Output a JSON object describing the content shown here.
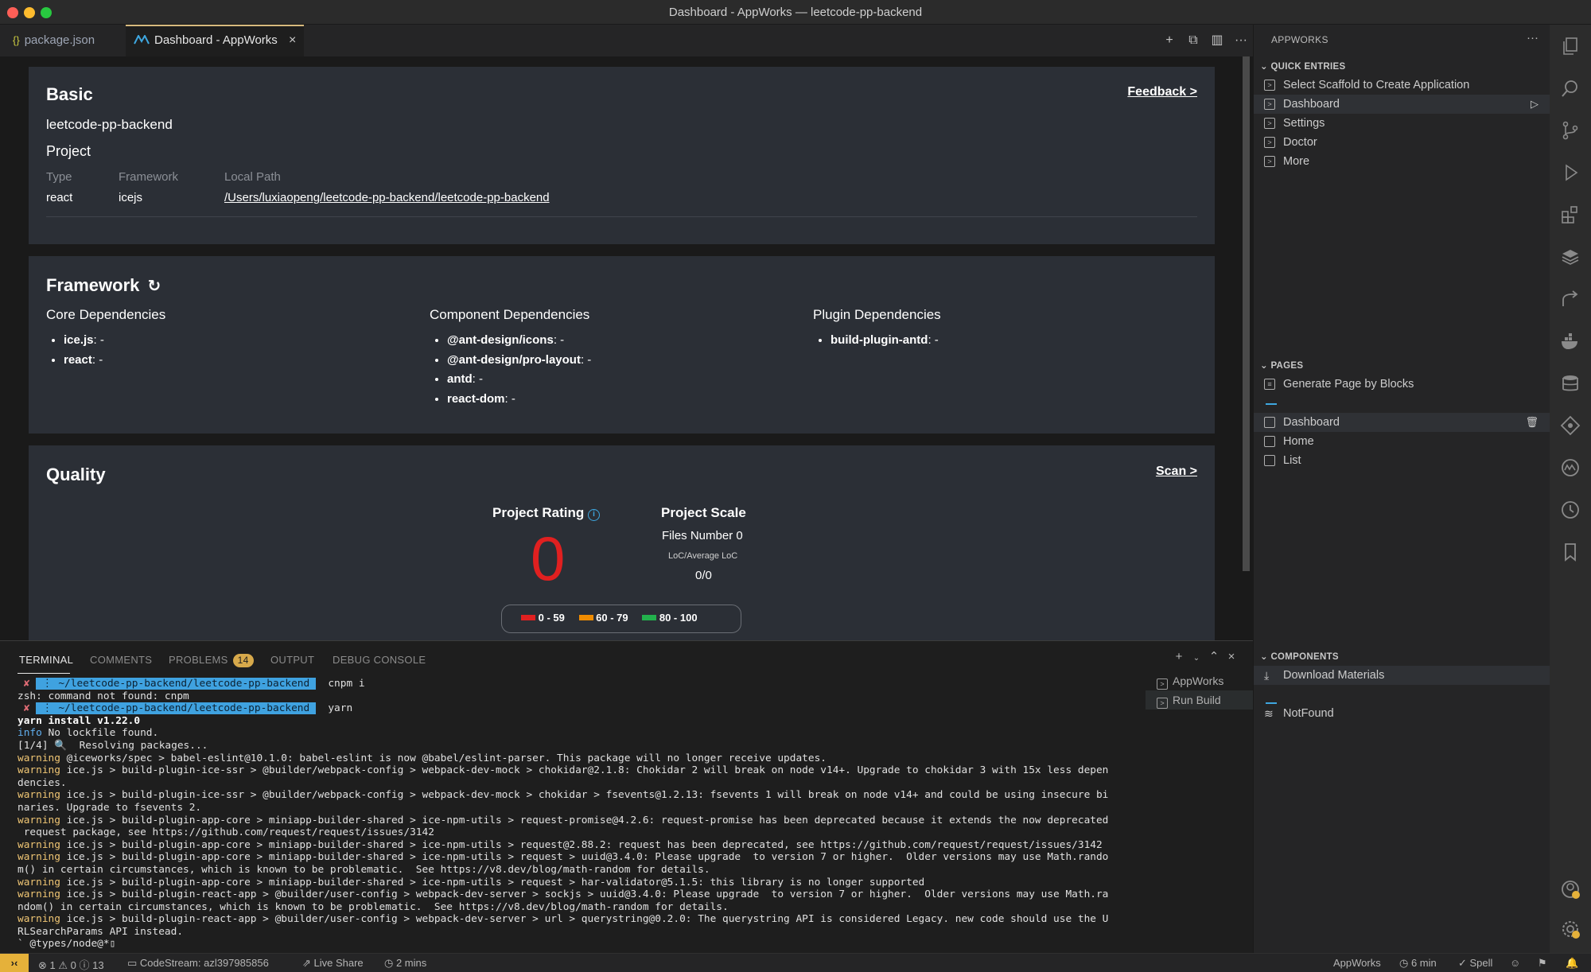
{
  "window": {
    "title": "Dashboard - AppWorks — leetcode-pp-backend"
  },
  "tabs": [
    {
      "label": "package.json",
      "icon": "{}"
    },
    {
      "label": "Dashboard - AppWorks"
    }
  ],
  "basic": {
    "heading": "Basic",
    "project_name": "leetcode-pp-backend",
    "feedback_link": "Feedback >",
    "subheading": "Project",
    "columns": {
      "type": "Type",
      "framework": "Framework",
      "local_path": "Local Path"
    },
    "values": {
      "type": "react",
      "framework": "icejs",
      "local_path": "/Users/luxiaopeng/leetcode-pp-backend/leetcode-pp-backend"
    }
  },
  "framework": {
    "heading": "Framework",
    "core": {
      "title": "Core Dependencies",
      "items": [
        {
          "name": "ice.js",
          "value": ": -"
        },
        {
          "name": "react",
          "value": ": -"
        }
      ]
    },
    "component": {
      "title": "Component Dependencies",
      "items": [
        {
          "name": "@ant-design/icons",
          "value": ": -"
        },
        {
          "name": "@ant-design/pro-layout",
          "value": ": -"
        },
        {
          "name": "antd",
          "value": ": -"
        },
        {
          "name": "react-dom",
          "value": ": -"
        }
      ]
    },
    "plugin": {
      "title": "Plugin Dependencies",
      "items": [
        {
          "name": "build-plugin-antd",
          "value": ": -"
        }
      ]
    }
  },
  "quality": {
    "heading": "Quality",
    "scan_link": "Scan >",
    "rating_label": "Project Rating",
    "rating_value": "0",
    "scale_label": "Project Scale",
    "files_number": "Files Number 0",
    "loc_label": "LoC/Average LoC",
    "loc_value": "0/0",
    "legend": [
      {
        "label": "0 - 59",
        "color": "#e02020"
      },
      {
        "label": "60 - 79",
        "color": "#f08c00"
      },
      {
        "label": "80 - 100",
        "color": "#22b14c"
      }
    ]
  },
  "panel": {
    "tabs": {
      "terminal": "TERMINAL",
      "comments": "COMMENTS",
      "problems": "PROBLEMS",
      "problems_count": "14",
      "output": "OUTPUT",
      "debug": "DEBUG CONSOLE"
    },
    "terminal_list": [
      "AppWorks",
      "Run Build"
    ],
    "terminal_lines": [
      {
        "type": "prompt",
        "path": "~/leetcode-pp-backend/leetcode-pp-backend",
        "cmd": "cnpm i"
      },
      {
        "type": "plain",
        "text": "zsh: command not found: cnpm"
      },
      {
        "type": "prompt",
        "path": "~/leetcode-pp-backend/leetcode-pp-backend",
        "cmd": "yarn"
      },
      {
        "type": "bold",
        "text": "yarn install v1.22.0"
      },
      {
        "type": "info",
        "tag": "info",
        "text": " No lockfile found."
      },
      {
        "type": "plain",
        "text": "[1/4] 🔍  Resolving packages..."
      },
      {
        "type": "warn",
        "tag": "warning",
        "text": " @iceworks/spec > babel-eslint@10.1.0: babel-eslint is now @babel/eslint-parser. This package will no longer receive updates."
      },
      {
        "type": "warn",
        "tag": "warning",
        "text": " ice.js > build-plugin-ice-ssr > @builder/webpack-config > webpack-dev-mock > chokidar@2.1.8: Chokidar 2 will break on node v14+. Upgrade to chokidar 3 with 15x less depen"
      },
      {
        "type": "plain",
        "text": "dencies."
      },
      {
        "type": "warn",
        "tag": "warning",
        "text": " ice.js > build-plugin-ice-ssr > @builder/webpack-config > webpack-dev-mock > chokidar > fsevents@1.2.13: fsevents 1 will break on node v14+ and could be using insecure bi"
      },
      {
        "type": "plain",
        "text": "naries. Upgrade to fsevents 2."
      },
      {
        "type": "warn",
        "tag": "warning",
        "text": " ice.js > build-plugin-app-core > miniapp-builder-shared > ice-npm-utils > request-promise@4.2.6: request-promise has been deprecated because it extends the now deprecated"
      },
      {
        "type": "plain",
        "text": " request package, see https://github.com/request/request/issues/3142"
      },
      {
        "type": "warn",
        "tag": "warning",
        "text": " ice.js > build-plugin-app-core > miniapp-builder-shared > ice-npm-utils > request@2.88.2: request has been deprecated, see https://github.com/request/request/issues/3142"
      },
      {
        "type": "warn",
        "tag": "warning",
        "text": " ice.js > build-plugin-app-core > miniapp-builder-shared > ice-npm-utils > request > uuid@3.4.0: Please upgrade  to version 7 or higher.  Older versions may use Math.rando"
      },
      {
        "type": "plain",
        "text": "m() in certain circumstances, which is known to be problematic.  See https://v8.dev/blog/math-random for details."
      },
      {
        "type": "warn",
        "tag": "warning",
        "text": " ice.js > build-plugin-app-core > miniapp-builder-shared > ice-npm-utils > request > har-validator@5.1.5: this library is no longer supported"
      },
      {
        "type": "warn",
        "tag": "warning",
        "text": " ice.js > build-plugin-react-app > @builder/user-config > webpack-dev-server > sockjs > uuid@3.4.0: Please upgrade  to version 7 or higher.  Older versions may use Math.ra"
      },
      {
        "type": "plain",
        "text": "ndom() in certain circumstances, which is known to be problematic.  See https://v8.dev/blog/math-random for details."
      },
      {
        "type": "warn",
        "tag": "warning",
        "text": " ice.js > build-plugin-react-app > @builder/user-config > webpack-dev-server > url > querystring@0.2.0: The querystring API is considered Legacy. new code should use the U"
      },
      {
        "type": "plain",
        "text": "RLSearchParams API instead."
      },
      {
        "type": "plain",
        "text": "` @types/node@*▯"
      }
    ]
  },
  "sidebar": {
    "title": "APPWORKS",
    "quick_entries": {
      "title": "QUICK ENTRIES",
      "items": [
        "Select Scaffold to Create Application",
        "Dashboard",
        "Settings",
        "Doctor",
        "More"
      ]
    },
    "pages": {
      "title": "PAGES",
      "generate": "Generate Page by Blocks",
      "items": [
        "Dashboard",
        "Home",
        "List"
      ]
    },
    "components": {
      "title": "COMPONENTS",
      "download": "Download Materials",
      "items": [
        "NotFound"
      ]
    }
  },
  "statusbar": {
    "errors": "1",
    "warnings": "0",
    "infos": "13",
    "codestream": "CodeStream: azl397985856",
    "liveshare": "Live Share",
    "time_left": "2 mins",
    "appworks": "AppWorks",
    "time_right": "6 min",
    "spell": "Spell"
  },
  "colors": {
    "accent": "#3ea7e0",
    "rating": "#e02020",
    "tab_accent": "#d7ba7d",
    "badge": "#d7a94b"
  }
}
